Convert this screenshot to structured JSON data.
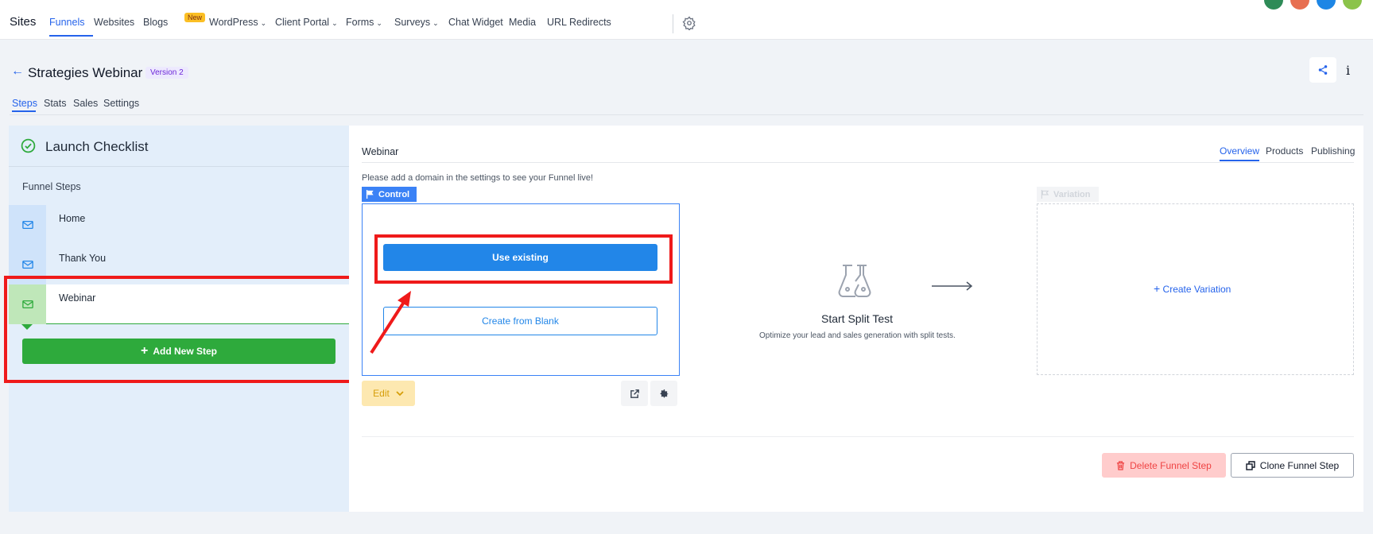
{
  "topnav": {
    "brand": "Sites",
    "items": [
      {
        "label": "Funnels",
        "active": true
      },
      {
        "label": "Websites"
      },
      {
        "label": "Blogs",
        "badge": "New"
      },
      {
        "label": "WordPress",
        "dropdown": true
      },
      {
        "label": "Client Portal",
        "dropdown": true
      },
      {
        "label": "Forms",
        "dropdown": true
      },
      {
        "label": "Surveys",
        "dropdown": true
      },
      {
        "label": "Chat Widget"
      },
      {
        "label": "Media"
      },
      {
        "label": "URL Redirects"
      }
    ],
    "settings_icon": "gear-icon",
    "avatar_colors": [
      "#2e8b57",
      "#e76f51",
      "#1d86e5",
      "#8bc34a"
    ]
  },
  "header": {
    "back_icon": "arrow-left-icon",
    "title": "Strategies Webinar",
    "version": "Version 2",
    "share_icon": "share-icon",
    "info_icon": "info-icon"
  },
  "subtabs": [
    {
      "label": "Steps",
      "active": true
    },
    {
      "label": "Stats"
    },
    {
      "label": "Sales"
    },
    {
      "label": "Settings"
    }
  ],
  "sidebar": {
    "checklist_title": "Launch Checklist",
    "steps_label": "Funnel Steps",
    "steps": [
      {
        "label": "Home",
        "icon": "mail-icon"
      },
      {
        "label": "Thank You",
        "icon": "mail-icon"
      },
      {
        "label": "Webinar",
        "icon": "mail-icon",
        "active": true
      }
    ],
    "add_step_label": "Add New Step"
  },
  "main": {
    "step_title": "Webinar",
    "tabs": [
      {
        "label": "Overview",
        "active": true
      },
      {
        "label": "Products"
      },
      {
        "label": "Publishing"
      }
    ],
    "notice": "Please add a domain in the settings to see your Funnel live!",
    "control": {
      "tag": "Control",
      "use_existing": "Use existing",
      "create_blank": "Create from Blank",
      "edit_label": "Edit"
    },
    "split": {
      "title": "Start Split Test",
      "subtitle": "Optimize your lead and sales generation with split tests."
    },
    "variation": {
      "tag": "Variation",
      "create_label": "Create Variation"
    },
    "delete_label": "Delete Funnel Step",
    "clone_label": "Clone Funnel Step"
  },
  "colors": {
    "accent": "#2563eb",
    "success": "#2eaa3c",
    "annotation": "#ef1a1a"
  }
}
